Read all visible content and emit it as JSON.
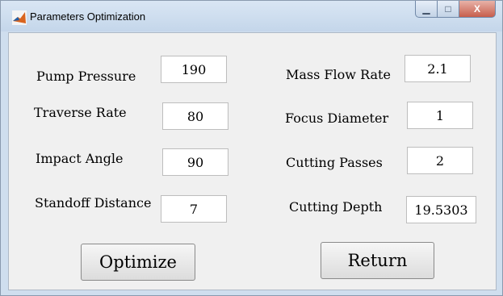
{
  "window": {
    "title": "Parameters Optimization"
  },
  "params_left": [
    {
      "label": "Pump Pressure",
      "value": "190"
    },
    {
      "label": "Traverse Rate",
      "value": "80"
    },
    {
      "label": "Impact Angle",
      "value": "90"
    },
    {
      "label": "Standoff Distance",
      "value": "7"
    }
  ],
  "params_right": [
    {
      "label": "Mass Flow Rate",
      "value": "2.1"
    },
    {
      "label": "Focus Diameter",
      "value": "1"
    },
    {
      "label": "Cutting Passes",
      "value": "2"
    },
    {
      "label": "Cutting Depth",
      "value": "19.5303"
    }
  ],
  "buttons": {
    "optimize": "Optimize",
    "return": "Return"
  },
  "title_controls": {
    "minimize": "▁",
    "maximize": "□",
    "close": "X"
  },
  "icons": {
    "app": "matlab-icon"
  }
}
